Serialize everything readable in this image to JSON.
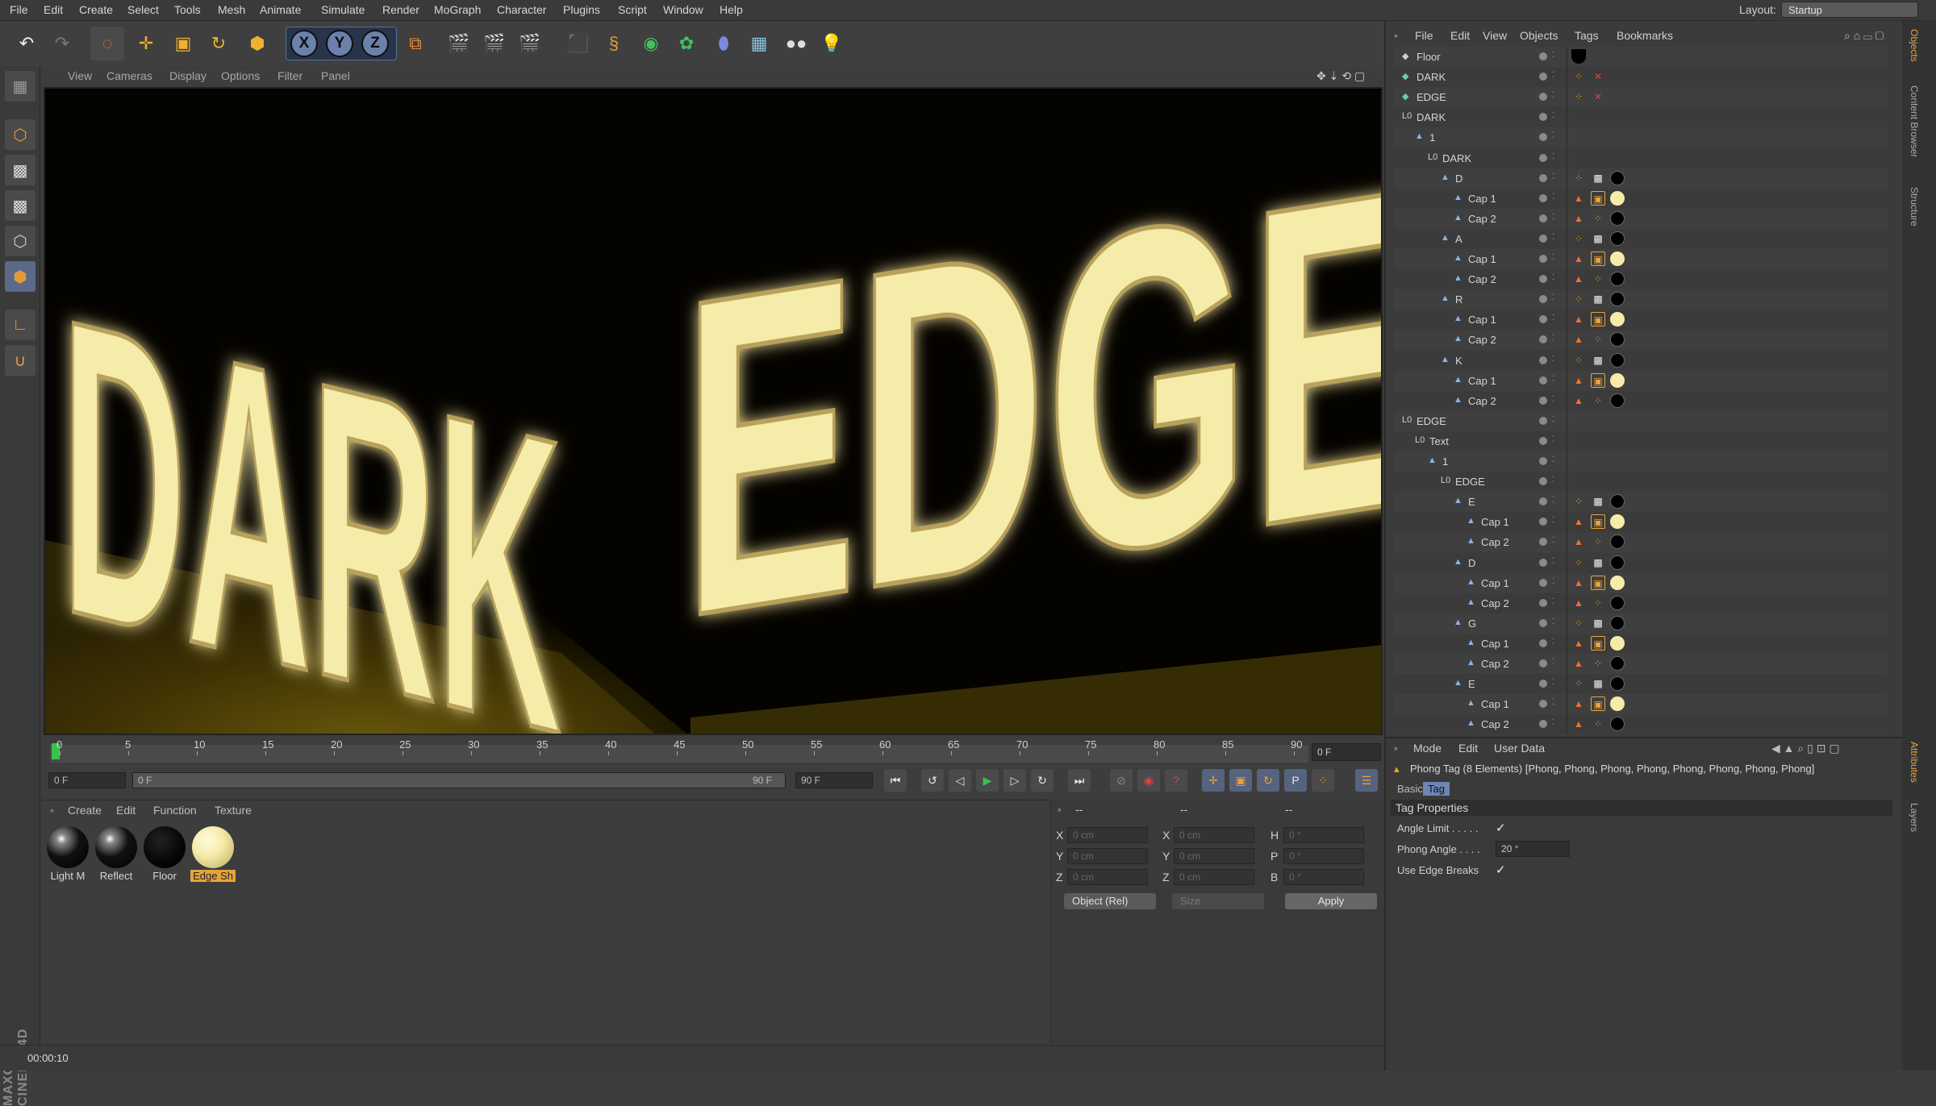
{
  "menu": [
    "File",
    "Edit",
    "Create",
    "Select",
    "Tools",
    "Mesh",
    "Animate",
    "Simulate",
    "Render",
    "MoGraph",
    "Character",
    "Plugins",
    "Script",
    "Window",
    "Help"
  ],
  "layout": {
    "label": "Layout:",
    "value": "Startup"
  },
  "viewport_menu": [
    "View",
    "Cameras",
    "Display",
    "Options",
    "Filter",
    "Panel"
  ],
  "viewport_text": [
    "DARK",
    "EDGE"
  ],
  "timeline": {
    "ticks": [
      "0",
      "5",
      "10",
      "15",
      "20",
      "25",
      "30",
      "35",
      "40",
      "45",
      "50",
      "55",
      "60",
      "65",
      "70",
      "75",
      "80",
      "85",
      "90"
    ],
    "frame_field": "0 F",
    "start_field": "0 F",
    "range_start": "0 F",
    "range_end": "90 F",
    "end_field": "90 F"
  },
  "material_manager": {
    "menu": [
      "Create",
      "Edit",
      "Function",
      "Texture"
    ],
    "materials": [
      {
        "label": "Light M",
        "type": "glossy-dark"
      },
      {
        "label": "Reflect",
        "type": "glossy-dark"
      },
      {
        "label": "Floor",
        "type": "black"
      },
      {
        "label": "Edge Sh",
        "type": "yellow",
        "selected": true
      }
    ]
  },
  "coordinates": {
    "headers": [
      "--",
      "--",
      "--"
    ],
    "rows": [
      {
        "a": "X",
        "av": "0 cm",
        "b": "X",
        "bv": "0 cm",
        "c": "H",
        "cv": "0 °"
      },
      {
        "a": "Y",
        "av": "0 cm",
        "b": "Y",
        "bv": "0 cm",
        "c": "P",
        "cv": "0 °"
      },
      {
        "a": "Z",
        "av": "0 cm",
        "b": "Z",
        "bv": "0 cm",
        "c": "B",
        "cv": "0 °"
      }
    ],
    "mode": "Object (Rel)",
    "size_mode": "Size",
    "apply": "Apply"
  },
  "object_manager": {
    "menu": [
      "File",
      "Edit",
      "View",
      "Objects",
      "Tags",
      "Bookmarks"
    ],
    "rows": [
      {
        "name": "Floor",
        "indent": 0,
        "tags": [
          "floor"
        ]
      },
      {
        "name": "DARK",
        "indent": 0,
        "tags": [
          "dots",
          "x"
        ]
      },
      {
        "name": "EDGE",
        "indent": 0,
        "tags": [
          "dots",
          "x"
        ]
      },
      {
        "name": "DARK",
        "indent": 0,
        "tags": []
      },
      {
        "name": "1",
        "indent": 1,
        "tags": []
      },
      {
        "name": "DARK",
        "indent": 2,
        "tags": []
      },
      {
        "name": "D",
        "indent": 3,
        "tags": [
          "dots",
          "check",
          "black"
        ]
      },
      {
        "name": "Cap 1",
        "indent": 4,
        "tags": [
          "tri",
          "sel",
          "yellow"
        ]
      },
      {
        "name": "Cap 2",
        "indent": 4,
        "tags": [
          "tri",
          "dots",
          "black"
        ]
      },
      {
        "name": "A",
        "indent": 3,
        "tags": [
          "dots",
          "check",
          "black"
        ]
      },
      {
        "name": "Cap 1",
        "indent": 4,
        "tags": [
          "tri",
          "sel",
          "yellow"
        ]
      },
      {
        "name": "Cap 2",
        "indent": 4,
        "tags": [
          "tri",
          "dots",
          "black"
        ]
      },
      {
        "name": "R",
        "indent": 3,
        "tags": [
          "dots",
          "check",
          "black"
        ]
      },
      {
        "name": "Cap 1",
        "indent": 4,
        "tags": [
          "tri",
          "sel",
          "yellow"
        ]
      },
      {
        "name": "Cap 2",
        "indent": 4,
        "tags": [
          "tri",
          "dots",
          "black"
        ]
      },
      {
        "name": "K",
        "indent": 3,
        "tags": [
          "dots",
          "check",
          "black"
        ]
      },
      {
        "name": "Cap 1",
        "indent": 4,
        "tags": [
          "tri",
          "sel",
          "yellow"
        ]
      },
      {
        "name": "Cap 2",
        "indent": 4,
        "tags": [
          "tri",
          "dots",
          "black"
        ]
      },
      {
        "name": "EDGE",
        "indent": 0,
        "tags": []
      },
      {
        "name": "Text",
        "indent": 1,
        "tags": []
      },
      {
        "name": "1",
        "indent": 2,
        "tags": []
      },
      {
        "name": "EDGE",
        "indent": 3,
        "tags": []
      },
      {
        "name": "E",
        "indent": 4,
        "tags": [
          "dots",
          "check",
          "black"
        ]
      },
      {
        "name": "Cap 1",
        "indent": 5,
        "tags": [
          "tri",
          "sel",
          "yellow"
        ]
      },
      {
        "name": "Cap 2",
        "indent": 5,
        "tags": [
          "tri",
          "dots",
          "black"
        ]
      },
      {
        "name": "D",
        "indent": 4,
        "tags": [
          "dots",
          "check",
          "black"
        ]
      },
      {
        "name": "Cap 1",
        "indent": 5,
        "tags": [
          "tri",
          "sel",
          "yellow"
        ]
      },
      {
        "name": "Cap 2",
        "indent": 5,
        "tags": [
          "tri",
          "dots",
          "black"
        ]
      },
      {
        "name": "G",
        "indent": 4,
        "tags": [
          "dots",
          "check",
          "black"
        ]
      },
      {
        "name": "Cap 1",
        "indent": 5,
        "tags": [
          "tri",
          "sel",
          "yellow"
        ]
      },
      {
        "name": "Cap 2",
        "indent": 5,
        "tags": [
          "tri",
          "dots",
          "black"
        ]
      },
      {
        "name": "E",
        "indent": 4,
        "tags": [
          "dots",
          "check",
          "black"
        ]
      },
      {
        "name": "Cap 1",
        "indent": 5,
        "tags": [
          "tri",
          "sel",
          "yellow"
        ]
      },
      {
        "name": "Cap 2",
        "indent": 5,
        "tags": [
          "tri",
          "dots",
          "black"
        ]
      }
    ]
  },
  "attributes": {
    "menu": [
      "Mode",
      "Edit",
      "User Data"
    ],
    "title": "Phong Tag (8 Elements) [Phong, Phong, Phong, Phong, Phong, Phong, Phong, Phong]",
    "tabs": [
      "Basic",
      "Tag"
    ],
    "section": "Tag Properties",
    "props": [
      {
        "label": "Angle Limit . . . . .",
        "value": "✓"
      },
      {
        "label": "Phong Angle . . . .",
        "value": "20 °"
      },
      {
        "label": "Use Edge Breaks",
        "value": "✓"
      }
    ]
  },
  "side_tabs": [
    "Objects",
    "Content Browser",
    "Structure",
    "Attributes",
    "Layers"
  ],
  "status": {
    "time": "00:00:10"
  },
  "brand": "MAXON CINEMA 4D",
  "colors": {
    "accent": "#e8a33a",
    "panel": "#3d3d3d",
    "cap_yellow": "#f6ecaa"
  }
}
